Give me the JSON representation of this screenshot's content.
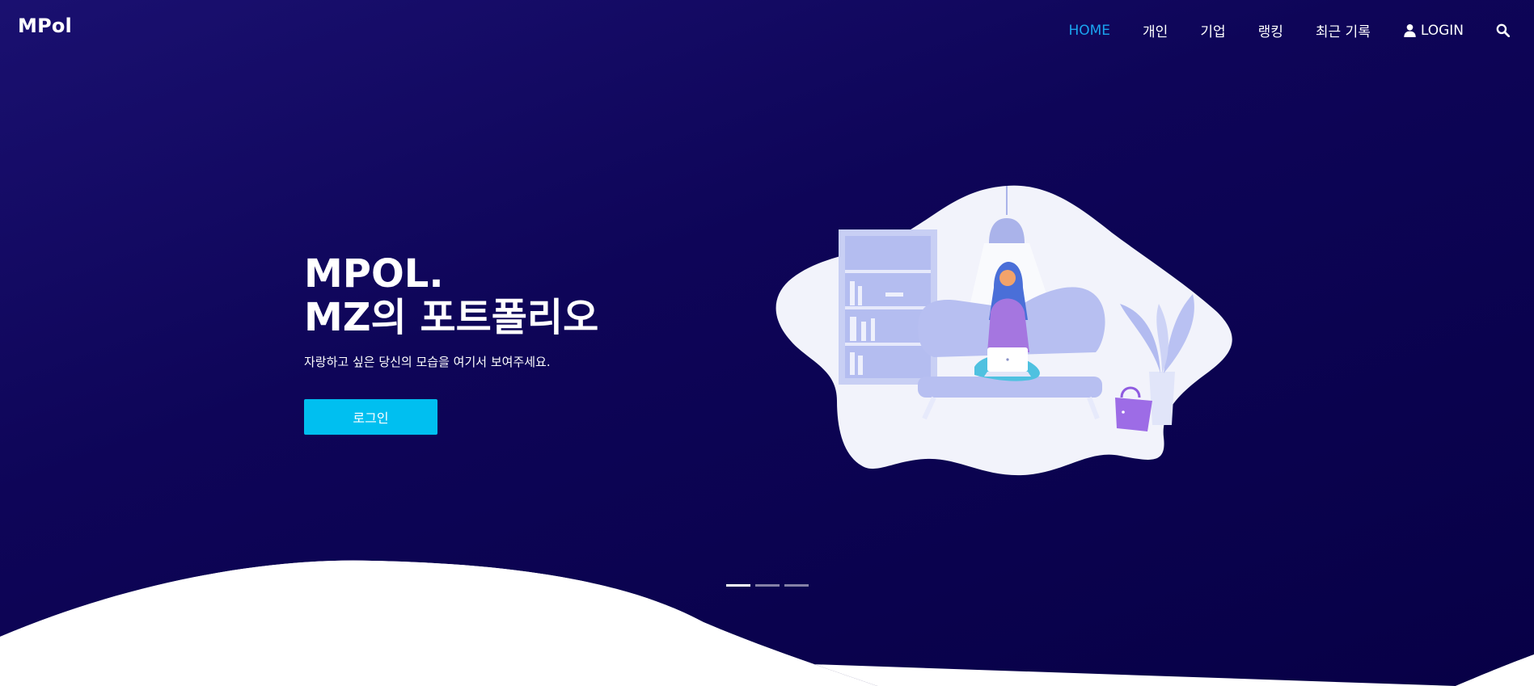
{
  "header": {
    "brand": "MPol",
    "nav": [
      {
        "label": "HOME",
        "active": true
      },
      {
        "label": "개인"
      },
      {
        "label": "기업"
      },
      {
        "label": "랭킹"
      },
      {
        "label": "최근 기록"
      },
      {
        "label": "LOGIN",
        "icon": "user-icon"
      },
      {
        "icon": "search-icon"
      }
    ]
  },
  "hero": {
    "headline_line1": "MPOL.",
    "headline_line2": "MZ의 포트폴리오",
    "subtitle": "자랑하고 싶은 당신의 모습을 여기서 보여주세요.",
    "cta_label": "로그인",
    "illustration": "woman-with-laptop-on-sofa-illustration"
  },
  "carousel": {
    "slides": 3,
    "active_index": 0
  },
  "colors": {
    "hero_background": "#0e0558",
    "accent": "#00bff0",
    "nav_active": "#1aa4f0"
  }
}
